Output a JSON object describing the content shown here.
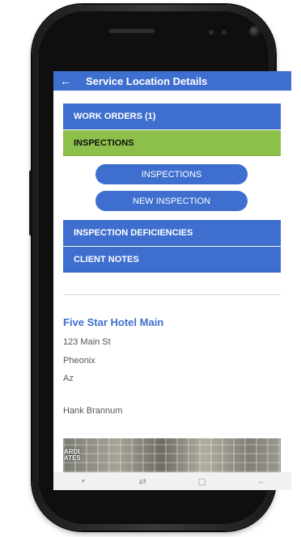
{
  "appbar": {
    "back_icon": "arrow-left-icon",
    "title": "Service Location Details"
  },
  "sections": {
    "work_orders": "WORK ORDERS (1)",
    "inspections": "INSPECTIONS",
    "inspection_deficiencies": "INSPECTION DEFICIENCIES",
    "client_notes": "CLIENT NOTES"
  },
  "inspection_actions": {
    "inspections_button": "INSPECTIONS",
    "new_inspection_button": "NEW INSPECTION"
  },
  "location": {
    "name": "Five Star Hotel Main",
    "street": "123 Main St",
    "city": "Pheonix",
    "state": "Az",
    "contact": "Hank Brannum"
  },
  "map": {
    "label": "ARDI\nATES"
  },
  "navbar": {
    "dot": "•",
    "recent_icon": "⇄",
    "home_icon": "▢",
    "back_icon": "←"
  },
  "colors": {
    "primary": "#3e6fcf",
    "active_section": "#8dc04a"
  }
}
